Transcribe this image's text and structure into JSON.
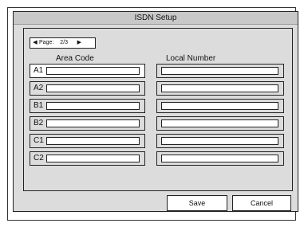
{
  "window": {
    "title": "ISDN Setup"
  },
  "pager": {
    "prev_icon": "triangle-left-icon",
    "label": "Page:",
    "value": "2/3",
    "next_icon": "triangle-right-icon"
  },
  "columns": {
    "area_code": "Area Code",
    "local_number": "Local Number"
  },
  "rows": [
    {
      "label": "A1",
      "area_code": "",
      "local_number": ""
    },
    {
      "label": "A2",
      "area_code": "",
      "local_number": ""
    },
    {
      "label": "B1",
      "area_code": "",
      "local_number": ""
    },
    {
      "label": "B2",
      "area_code": "",
      "local_number": ""
    },
    {
      "label": "C1",
      "area_code": "",
      "local_number": ""
    },
    {
      "label": "C2",
      "area_code": "",
      "local_number": ""
    }
  ],
  "buttons": {
    "save": "Save",
    "cancel": "Cancel"
  },
  "colors": {
    "background": "#dcdcdc",
    "field": "#ffffff",
    "border": "#222222"
  }
}
